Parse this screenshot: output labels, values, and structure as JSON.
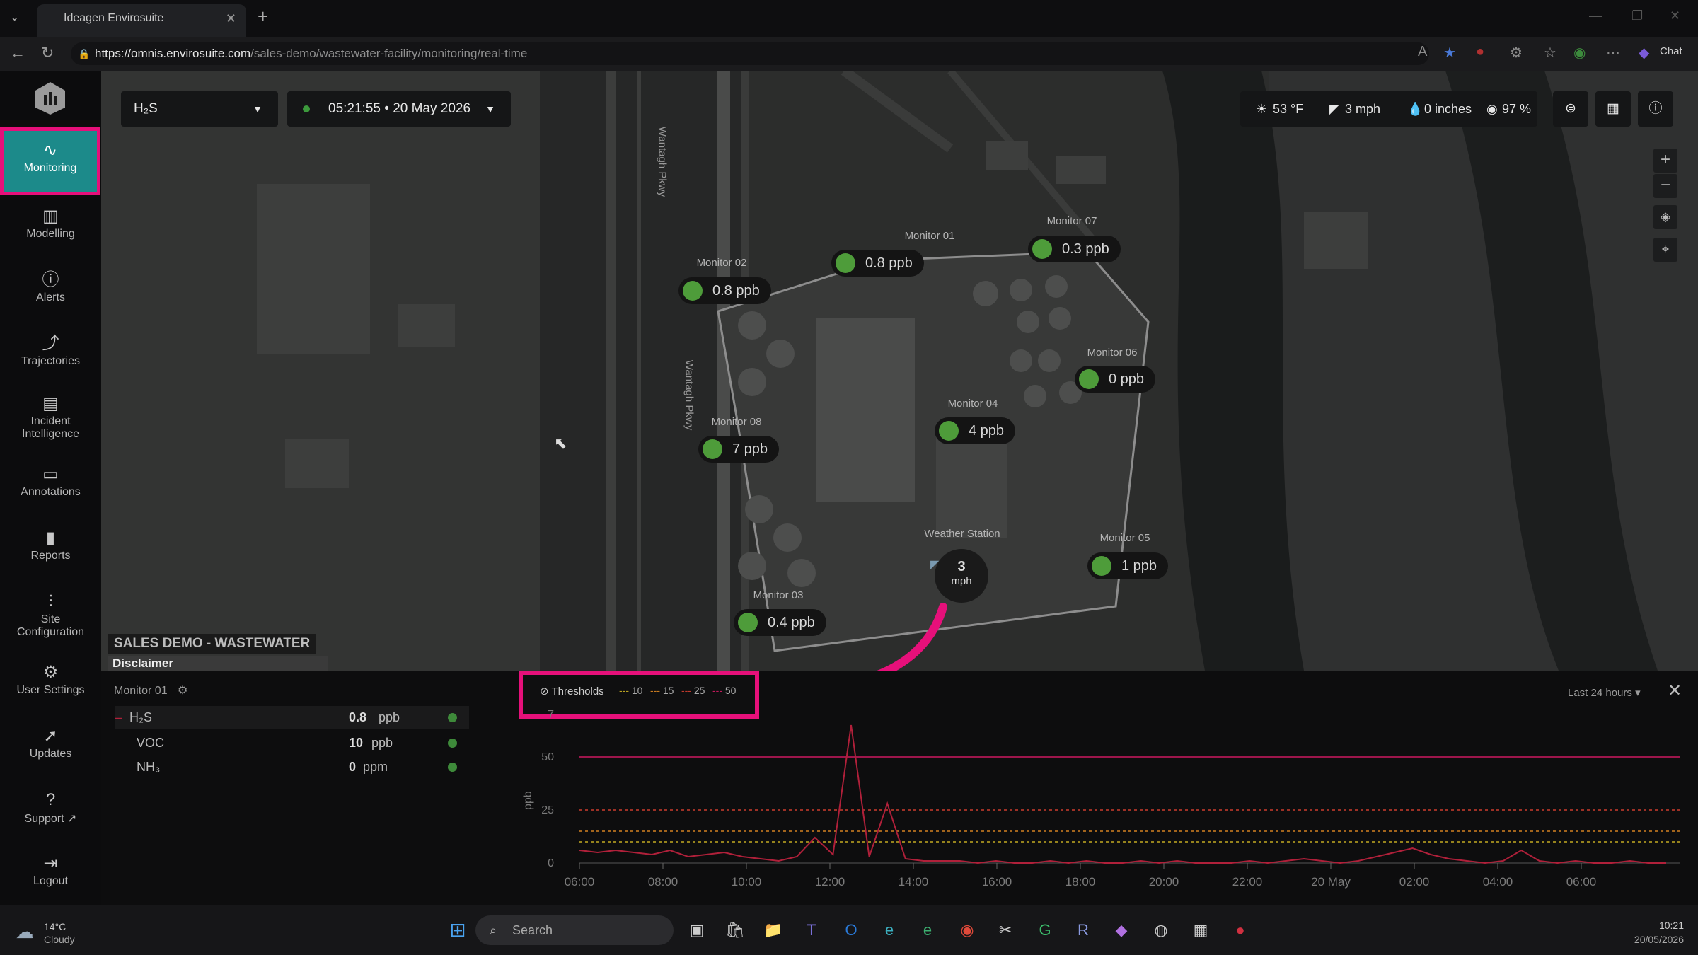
{
  "browser": {
    "tab_title": "Ideagen Envirosuite",
    "url_host": "https://omnis.envirosuite.com",
    "url_path": "/sales-demo/wastewater-facility/monitoring/real-time",
    "chat_label": "Chat"
  },
  "sidebar": {
    "items": [
      {
        "label": "Monitoring",
        "icon": "activity-icon"
      },
      {
        "label": "Modelling",
        "icon": "modelling-icon"
      },
      {
        "label": "Alerts",
        "icon": "alert-circle-icon"
      },
      {
        "label": "Trajectories",
        "icon": "trajectory-icon"
      },
      {
        "label": "Incident Intelligence",
        "icon": "incident-icon"
      },
      {
        "label": "Annotations",
        "icon": "annotation-icon"
      },
      {
        "label": "Reports",
        "icon": "bar-chart-icon"
      },
      {
        "label": "Site Configuration",
        "icon": "sliders-icon"
      },
      {
        "label": "User Settings",
        "icon": "gear-icon"
      },
      {
        "label": "Updates",
        "icon": "rocket-icon"
      },
      {
        "label": "Support",
        "icon": "help-icon"
      },
      {
        "label": "Logout",
        "icon": "logout-icon"
      }
    ]
  },
  "toolbar": {
    "pollutant": "H₂S",
    "time": "05:21:55",
    "date": "20 May 2026"
  },
  "weather": {
    "temp": "53 °F",
    "wind": "3 mph",
    "rain": "0 inches",
    "humidity": "97 %"
  },
  "map": {
    "site_name": "SALES DEMO - WASTEWATER",
    "disclaimer": "Disclaimer",
    "roads": [
      "Wantagh Pkwy",
      "Wantagh Pkwy"
    ],
    "monitors": [
      {
        "name": "Monitor 01",
        "value": "0.8 ppb"
      },
      {
        "name": "Monitor 02",
        "value": "0.8 ppb"
      },
      {
        "name": "Monitor 07",
        "value": "0.3 ppb"
      },
      {
        "name": "Monitor 06",
        "value": "0 ppb"
      },
      {
        "name": "Monitor 08",
        "value": "7 ppb"
      },
      {
        "name": "Monitor 04",
        "value": "4 ppb"
      },
      {
        "name": "Monitor 05",
        "value": "1 ppb"
      },
      {
        "name": "Monitor 03",
        "value": "0.4 ppb"
      }
    ],
    "weather_station": {
      "label": "Weather Station",
      "speed": "3",
      "unit": "mph"
    }
  },
  "panel": {
    "monitor": "Monitor 01",
    "rows": [
      {
        "name": "H₂S",
        "value": "0.8",
        "unit": "ppb"
      },
      {
        "name": "VOC",
        "value": "10",
        "unit": "ppb"
      },
      {
        "name": "NH₃",
        "value": "0",
        "unit": "ppm"
      }
    ],
    "thresholds_label": "Thresholds",
    "thresholds": [
      "10",
      "15",
      "25",
      "50"
    ],
    "range": "Last 24 hours"
  },
  "chart_data": {
    "type": "line",
    "ylabel": "ppb",
    "ylim": [
      0,
      70
    ],
    "yticks": [
      "0",
      "25",
      "50",
      "7"
    ],
    "x": [
      "06:00",
      "08:00",
      "10:00",
      "12:00",
      "14:00",
      "16:00",
      "18:00",
      "20:00",
      "22:00",
      "20 May",
      "02:00",
      "04:00",
      "06:00"
    ],
    "threshold_values": [
      10,
      15,
      25,
      50
    ],
    "colors": {
      "line": "#b0203a",
      "threshold50": "#c2185b",
      "threshold25": "#c0392b",
      "threshold15": "#c87a20",
      "threshold10": "#b8a020"
    },
    "series": [
      {
        "values": [
          6,
          5,
          6,
          5,
          4,
          6,
          3,
          4,
          5,
          3,
          2,
          1,
          3,
          12,
          4,
          65,
          3,
          28,
          2,
          1,
          1,
          1,
          0,
          1,
          0,
          0,
          1,
          0,
          1,
          0,
          0,
          1,
          0,
          1,
          0,
          0,
          0,
          1,
          0,
          1,
          2,
          1,
          0,
          1,
          3,
          5,
          7,
          4,
          2,
          1,
          0,
          1,
          6,
          1,
          0,
          1,
          0,
          0,
          1,
          0,
          0
        ]
      }
    ]
  },
  "taskbar": {
    "weather_temp": "14°C",
    "weather_desc": "Cloudy",
    "search": "Search",
    "clock_time": "10:21",
    "clock_date": "20/05/2026"
  }
}
